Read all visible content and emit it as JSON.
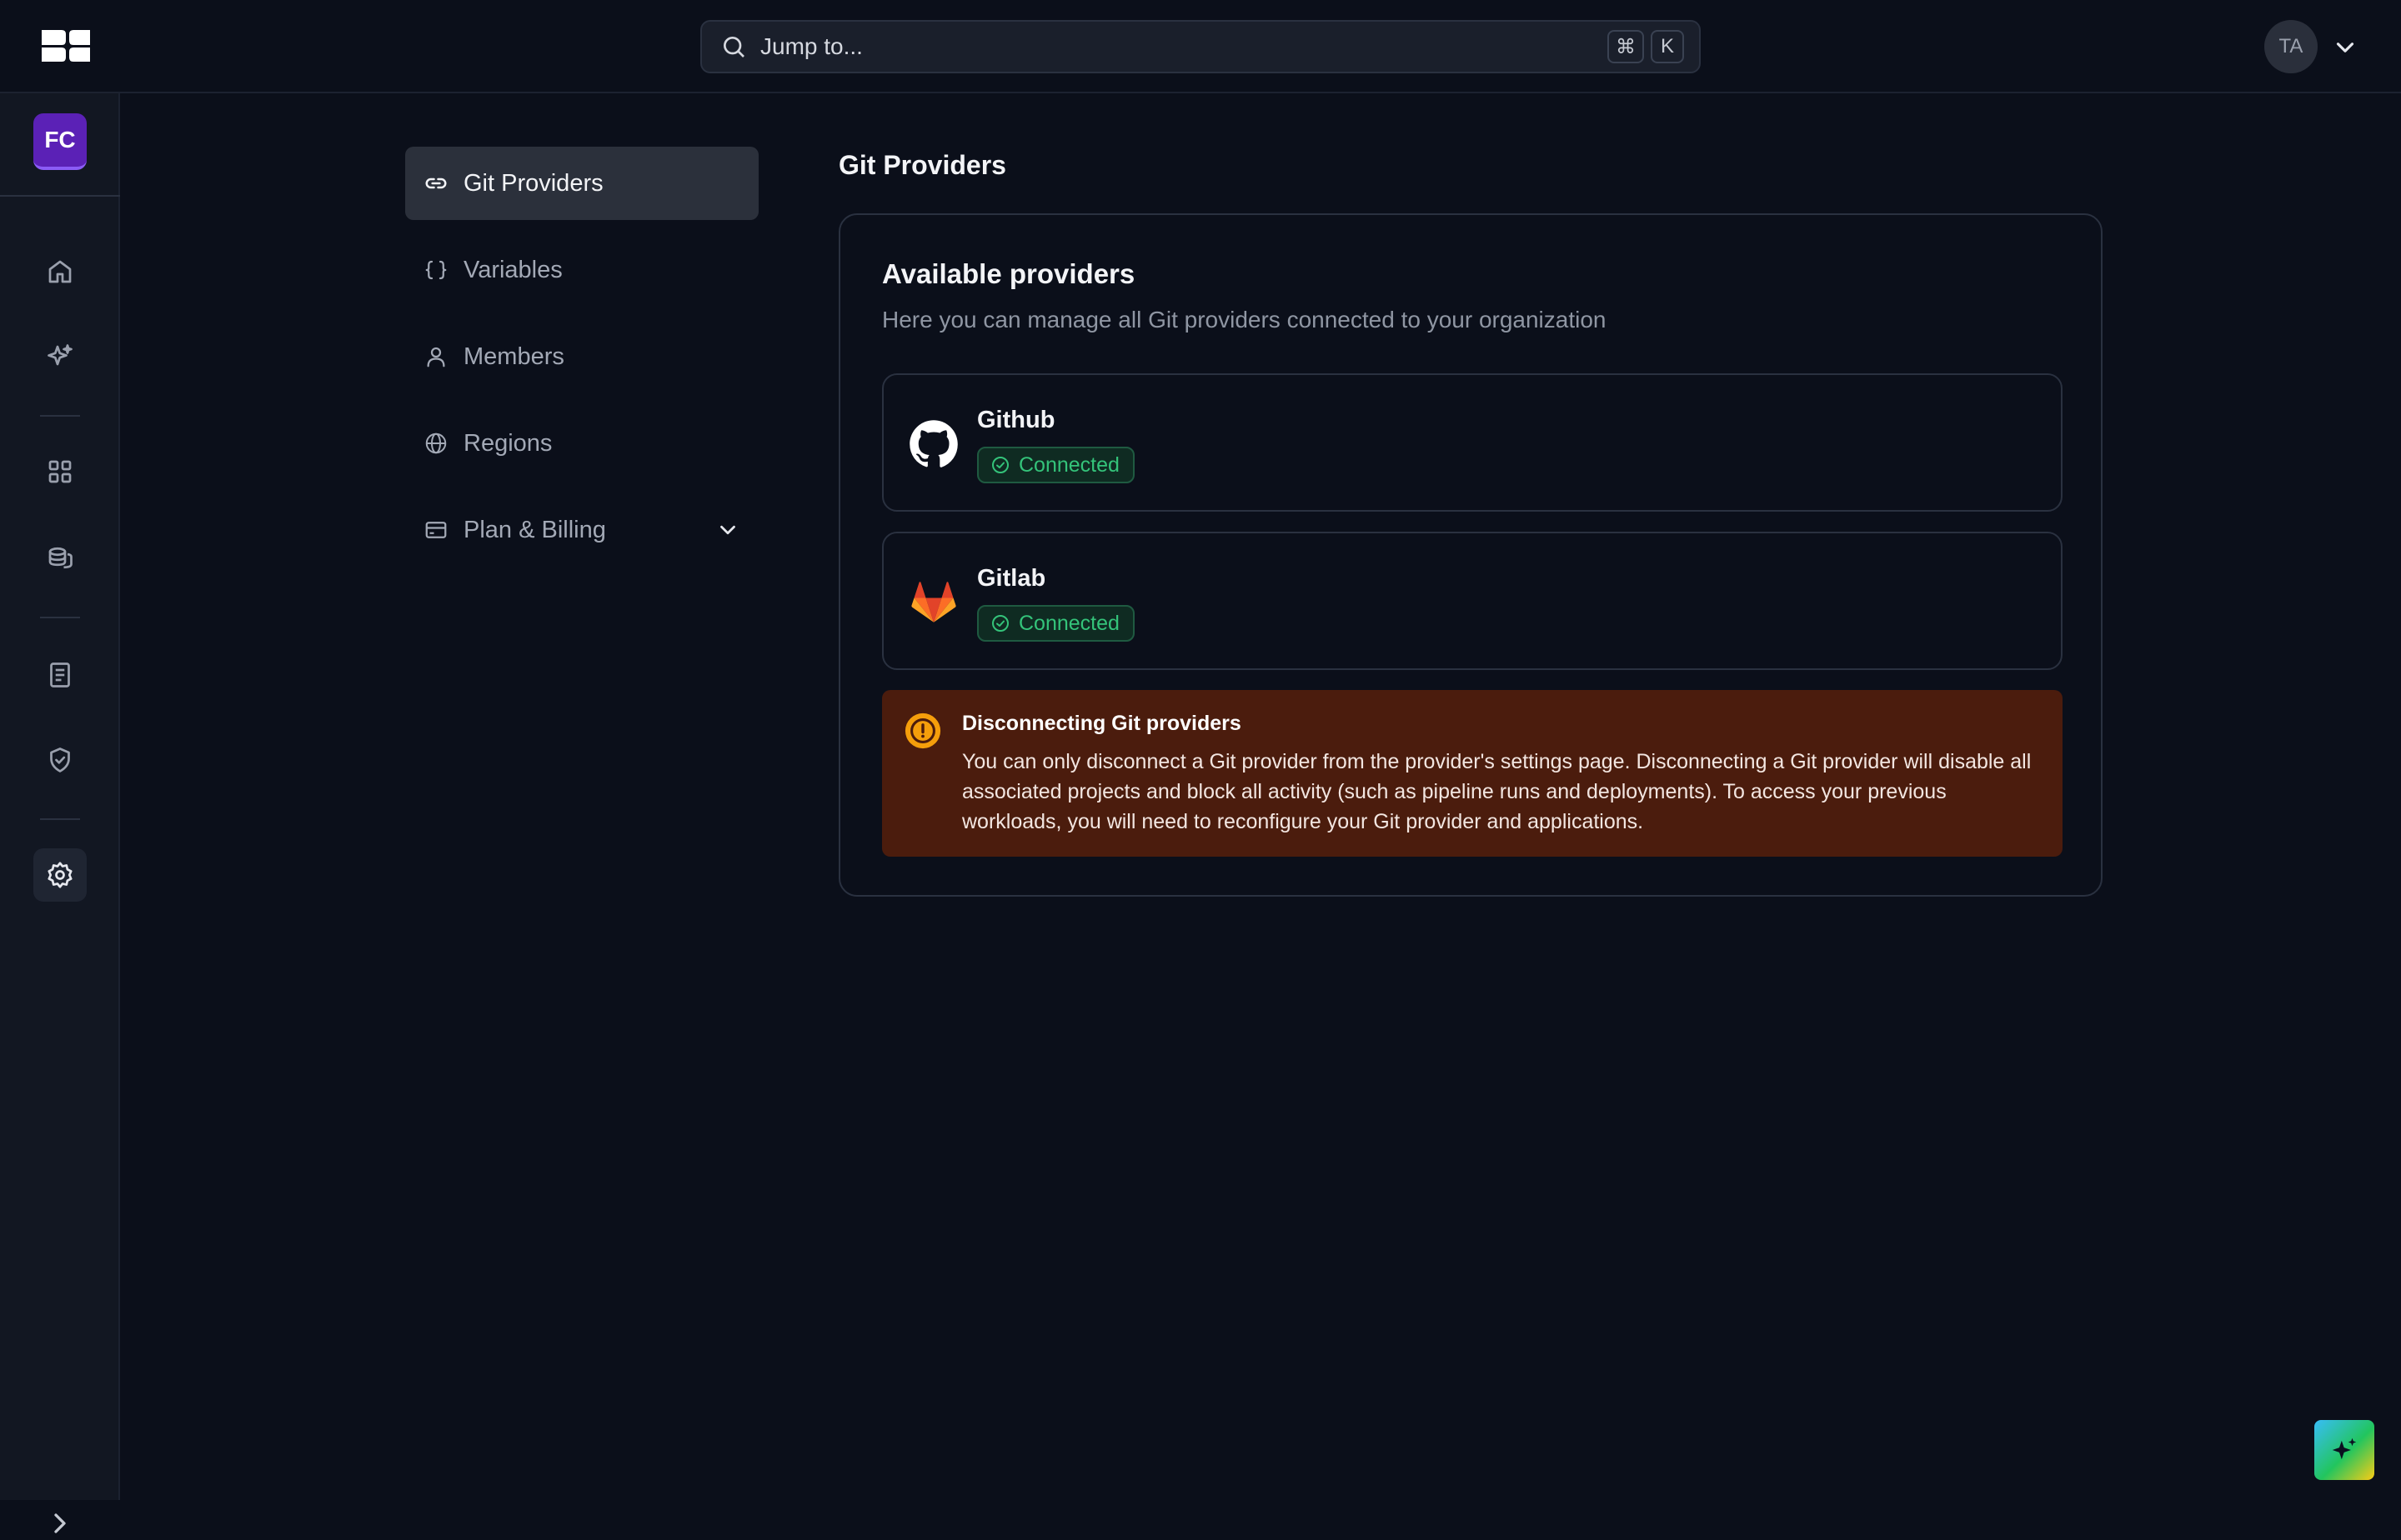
{
  "header": {
    "search_placeholder": "Jump to...",
    "shortcut_keys": [
      "⌘",
      "K"
    ],
    "user_initials": "TA"
  },
  "rail": {
    "org_initials": "FC",
    "items": [
      {
        "icon": "home-icon"
      },
      {
        "icon": "sparkles-icon"
      },
      {
        "icon": "grid-icon"
      },
      {
        "icon": "database-icon"
      },
      {
        "icon": "document-icon"
      },
      {
        "icon": "shield-check-icon"
      },
      {
        "icon": "gear-icon",
        "active": true
      }
    ]
  },
  "subnav": {
    "items": [
      {
        "label": "Git Providers",
        "icon": "link-icon",
        "active": true
      },
      {
        "label": "Variables",
        "icon": "braces-icon"
      },
      {
        "label": "Members",
        "icon": "user-icon"
      },
      {
        "label": "Regions",
        "icon": "globe-icon"
      },
      {
        "label": "Plan & Billing",
        "icon": "credit-card-icon",
        "has_caret": true
      }
    ]
  },
  "page": {
    "title": "Git Providers",
    "card_title": "Available providers",
    "card_subtitle": "Here you can manage all Git providers connected to your organization",
    "providers": [
      {
        "name": "Github",
        "status": "Connected",
        "icon": "github-icon"
      },
      {
        "name": "Gitlab",
        "status": "Connected",
        "icon": "gitlab-icon"
      }
    ],
    "warning": {
      "title": "Disconnecting Git providers",
      "body": "You can only disconnect a Git provider from the provider's settings page. Disconnecting a Git provider will disable all associated projects and block all activity (such as pipeline runs and deployments). To access your previous workloads, you will need to reconfigure your Git provider and applications."
    }
  },
  "colors": {
    "background": "#0b0f1a",
    "rail": "#121722",
    "org_avatar": "#5b21b6",
    "connected_green": "#34c37a",
    "warning_bg": "#4b1c0d",
    "warning_icon": "#f59e0b"
  }
}
